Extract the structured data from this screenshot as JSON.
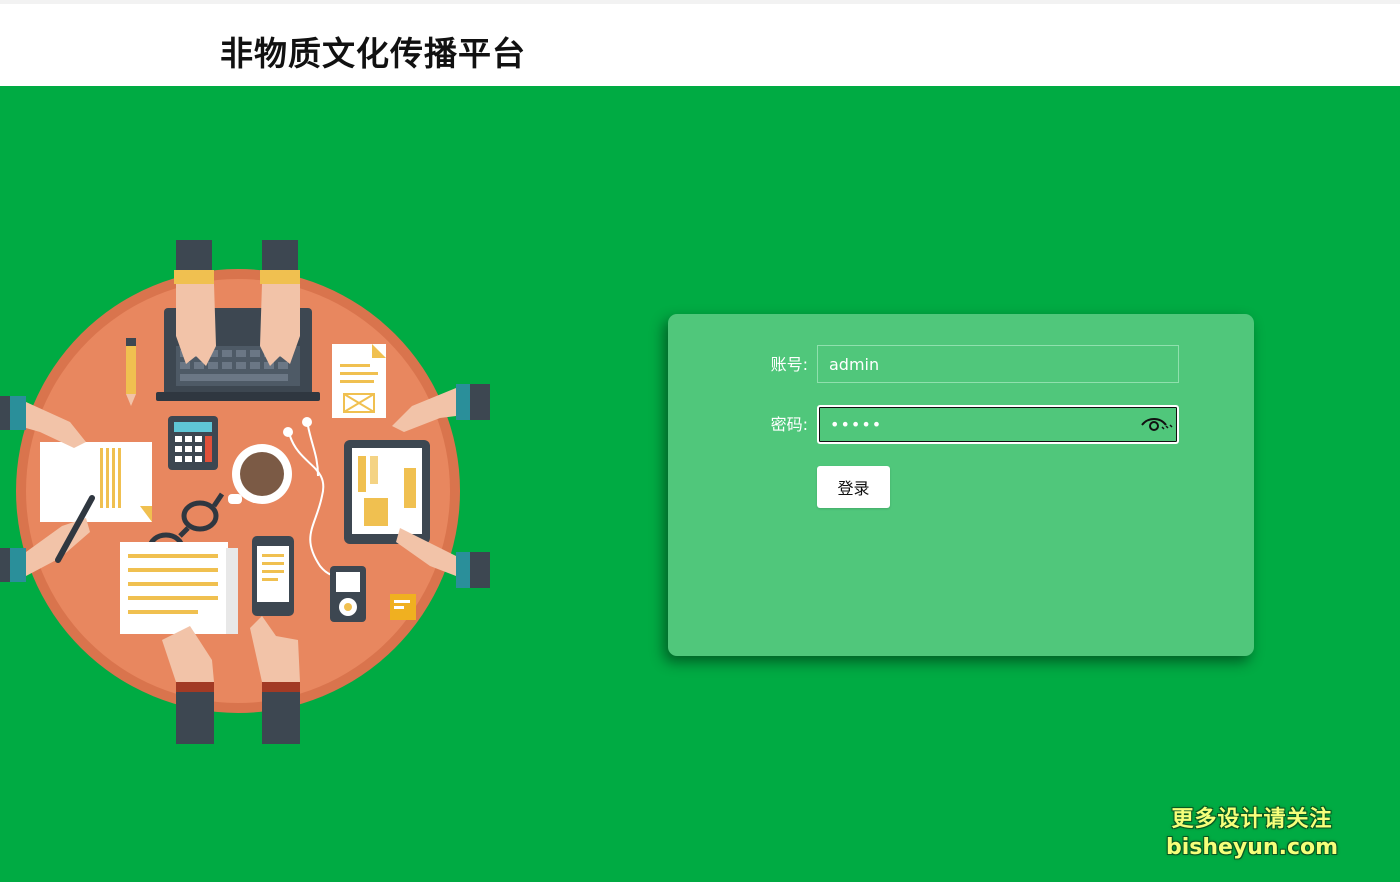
{
  "header": {
    "title": "非物质文化传播平台"
  },
  "login": {
    "account_label": "账号:",
    "account_value": "admin",
    "password_label": "密码:",
    "password_value": "•••••",
    "submit_label": "登录"
  },
  "watermark": {
    "line1": "更多设计请关注",
    "line2": "bisheyun.com"
  },
  "icons": {
    "password_toggle": "eye-icon"
  },
  "colors": {
    "main_background": "#00ab43",
    "card_background": "#50c77b",
    "button_background": "#ffffff",
    "table_orange": "#e8875f"
  }
}
